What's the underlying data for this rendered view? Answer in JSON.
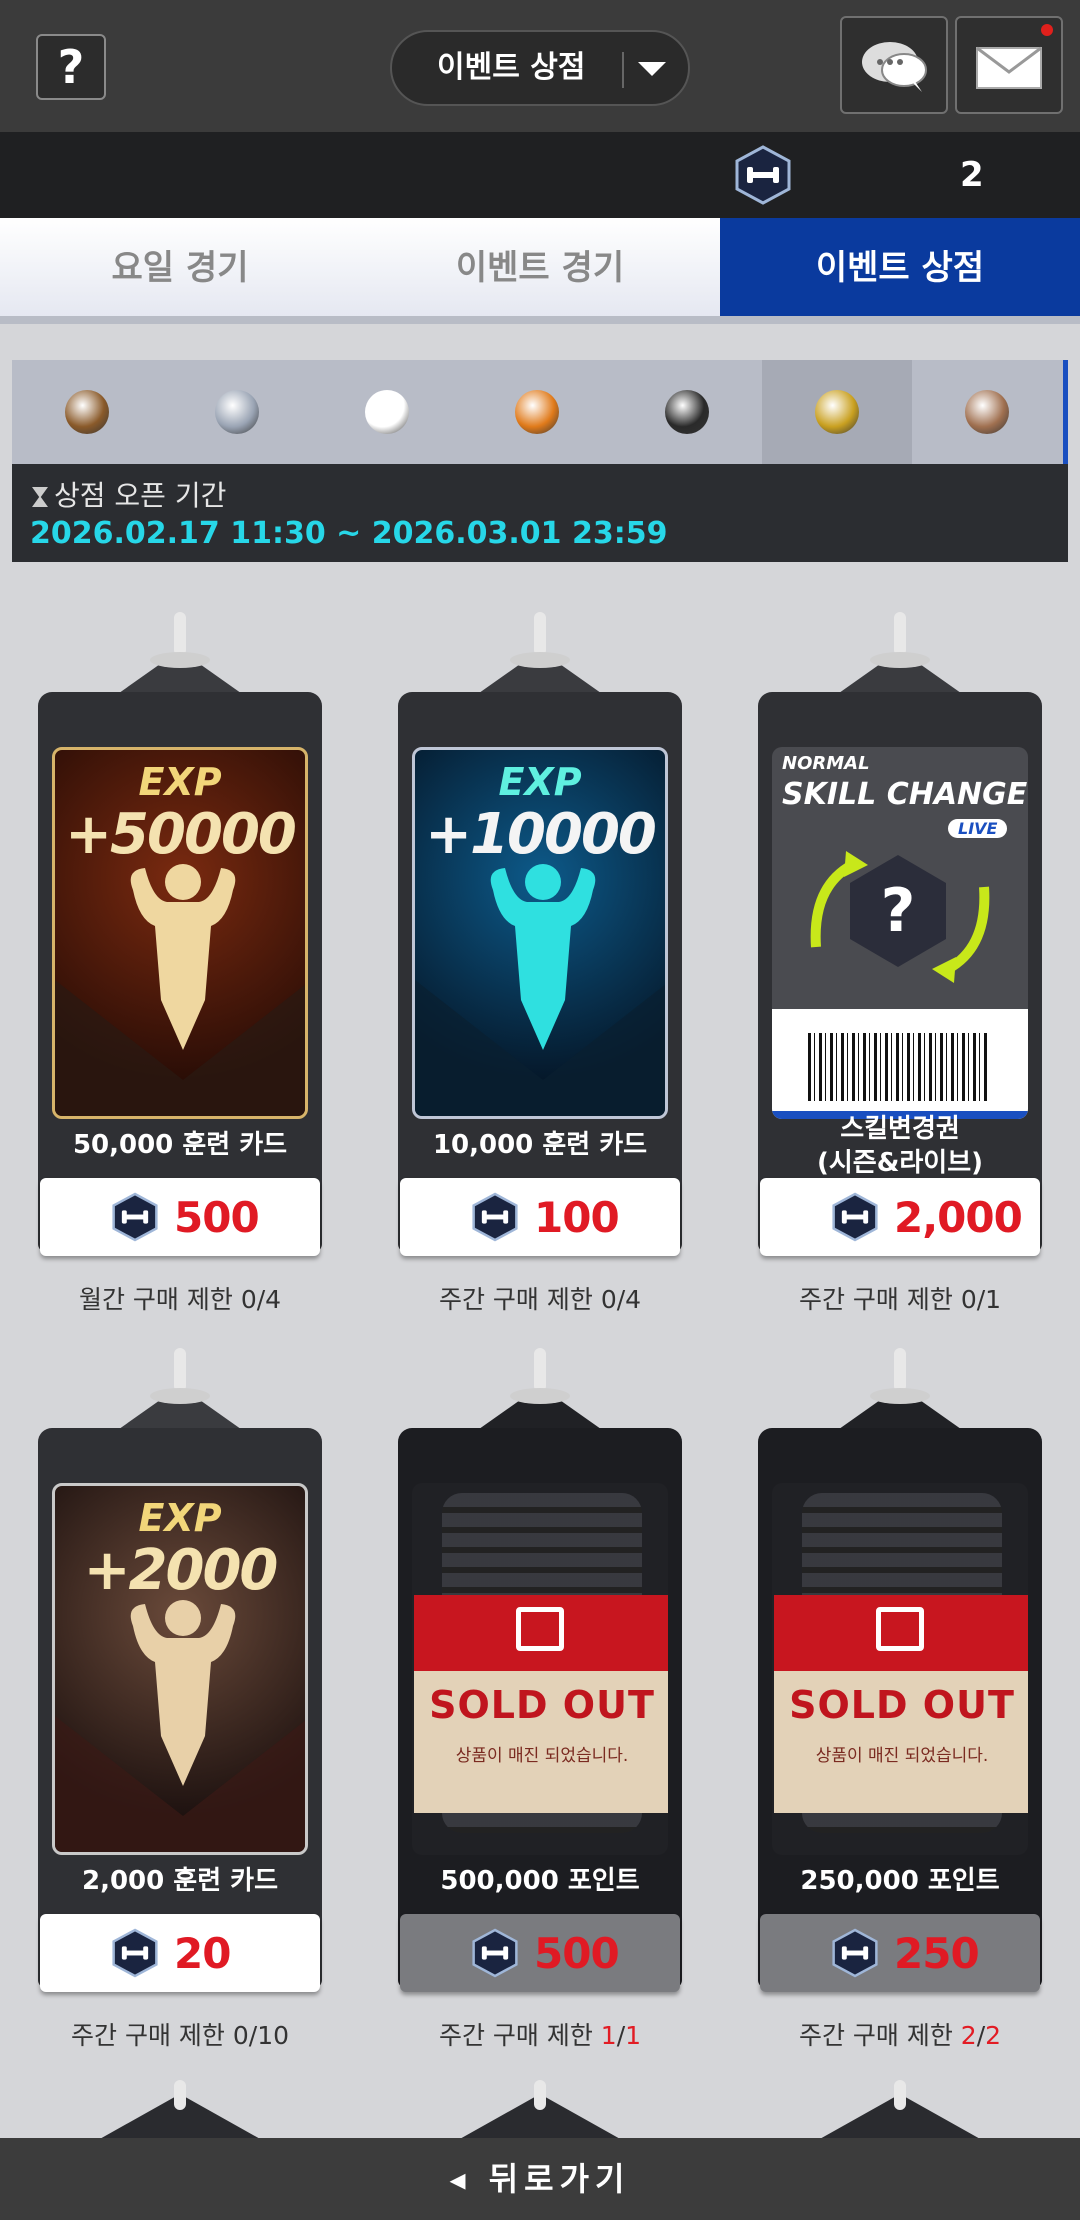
{
  "header": {
    "help_label": "?",
    "title": "이벤트 상점",
    "chat_icon": "chat-bubble-icon",
    "mail_icon": "mail-envelope-icon",
    "has_notification": true
  },
  "currency": {
    "icon": "dumbbell-token-icon",
    "count": "2"
  },
  "tabs": [
    {
      "label": "요일 경기",
      "active": false
    },
    {
      "label": "이벤트 경기",
      "active": false
    },
    {
      "label": "이벤트 상점",
      "active": true
    }
  ],
  "league_filters": [
    {
      "icon": "star-league-badge-icon",
      "color": "#8a5a2a",
      "selected": false
    },
    {
      "icon": "silver-league-badge-icon",
      "color": "#9aa4b4",
      "selected": false
    },
    {
      "icon": "korea-flag-badge-icon",
      "color": "#ffffff",
      "selected": false
    },
    {
      "icon": "orange-league-badge-icon",
      "color": "#e07a1a",
      "selected": false
    },
    {
      "icon": "black-league-badge-icon",
      "color": "#2a2a2a",
      "selected": false
    },
    {
      "icon": "gold-shield-badge-icon",
      "color": "#c9a020",
      "selected": true
    },
    {
      "icon": "bronze-league-badge-icon",
      "color": "#a07050",
      "selected": false
    }
  ],
  "open_period": {
    "label": "상점 오픈 기간",
    "dates": "2026.02.17 11:30 ~ 2026.03.01 23:59"
  },
  "products": [
    {
      "name": "50,000 훈련 카드",
      "art": {
        "exp_label": "EXP",
        "exp_value": "+50000"
      },
      "price": "500",
      "limit_text": "월간 구매 제한",
      "limit_value": "0/4",
      "sold_out": false
    },
    {
      "name": "10,000 훈련 카드",
      "art": {
        "exp_label": "EXP",
        "exp_value": "+10000"
      },
      "price": "100",
      "limit_text": "주간 구매 제한",
      "limit_value": "0/4",
      "sold_out": false
    },
    {
      "name_line1": "스킬변경권",
      "name_line2": "(시즌&라이브)",
      "art": {
        "line1": "NORMAL",
        "line2": "SKILL CHANGE",
        "badge": "LIVE",
        "symbol": "?"
      },
      "price": "2,000",
      "limit_text": "주간 구매 제한",
      "limit_value": "0/1",
      "sold_out": false
    },
    {
      "name": "2,000 훈련 카드",
      "art": {
        "exp_label": "EXP",
        "exp_value": "+2000"
      },
      "price": "20",
      "limit_text": "주간 구매 제한",
      "limit_value": "0/10",
      "sold_out": false
    },
    {
      "name": "500,000 포인트",
      "art": {
        "sold_out_label": "SOLD OUT",
        "sold_out_sub": "상품이 매진 되었습니다."
      },
      "price": "500",
      "limit_text": "주간 구매 제한",
      "limit_a": "1",
      "limit_b": "1",
      "sold_out": true
    },
    {
      "name": "250,000 포인트",
      "art": {
        "sold_out_label": "SOLD OUT",
        "sold_out_sub": "상품이 매진 되었습니다."
      },
      "price": "250",
      "limit_text": "주간 구매 제한",
      "limit_a": "2",
      "limit_b": "2",
      "sold_out": true
    }
  ],
  "footer": {
    "back_label": "◂ 뒤로가기"
  }
}
